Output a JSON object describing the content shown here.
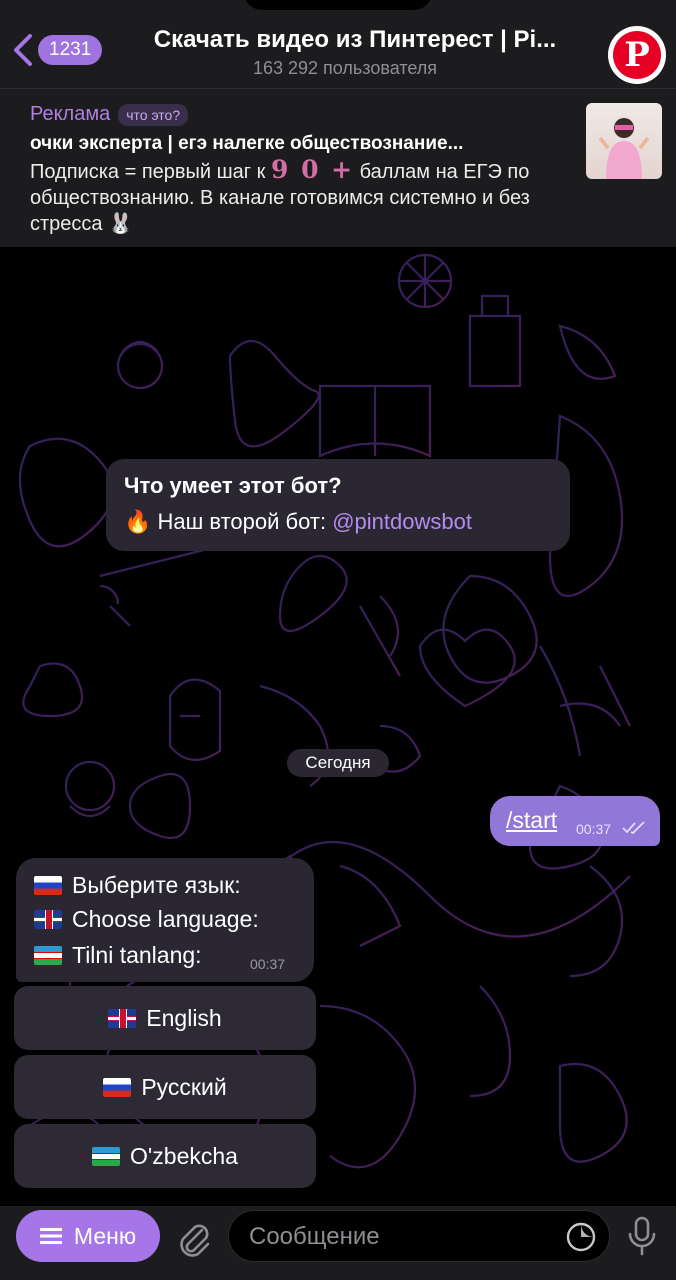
{
  "header": {
    "back_count": "1231",
    "title": "Скачать видео из Пинтерест | Pi...",
    "subtitle": "163 292 пользователя"
  },
  "ad": {
    "label": "Реклама",
    "what_label": "что это?",
    "title": "очки эксперта | егэ налегке обществознание...",
    "text_before": "Подписка = первый шаг к ",
    "highlight": "9 0 +",
    "text_after": " баллам на ЕГЭ по обществознанию. В канале готовимся системно и без стресса 🐰"
  },
  "bot_info": {
    "question": "Что умеет этот бот?",
    "answer_prefix": "🔥 Наш второй бот: ",
    "answer_link": "@pintdowsbot"
  },
  "date_divider": "Сегодня",
  "outgoing": {
    "text": "/start",
    "time": "00:37"
  },
  "incoming": {
    "line_ru": "Выберите язык:",
    "line_en": "Choose language:",
    "line_uz": "Tilni tanlang:",
    "time": "00:37"
  },
  "keyboard": {
    "english": "English",
    "russian": "Русский",
    "uzbek": "O'zbekcha"
  },
  "bottom": {
    "menu_label": "Меню",
    "input_placeholder": "Сообщение"
  },
  "colors": {
    "accent": "#a676e8",
    "outgoing_bubble": "#9077d8",
    "incoming_bubble": "#2a2732",
    "link": "#b48cf0"
  }
}
